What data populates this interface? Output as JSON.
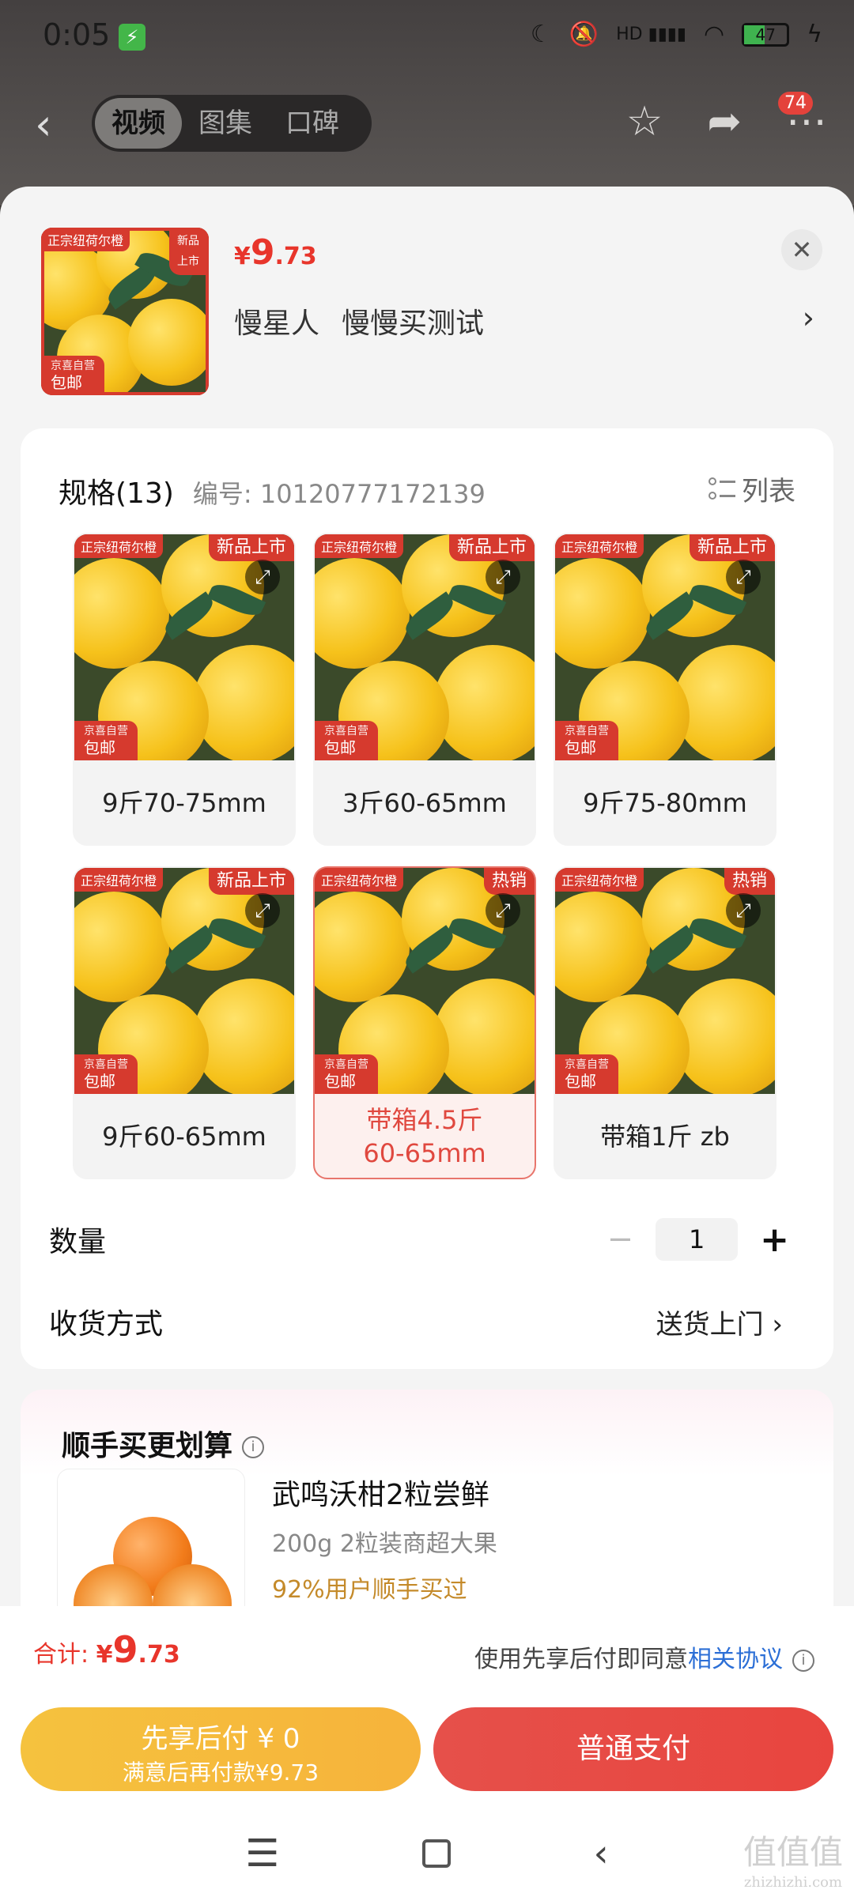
{
  "status_bar": {
    "time": "0:05",
    "hd": "HD",
    "battery": "47"
  },
  "nav": {
    "tabs": [
      "视频",
      "图集",
      "口碑"
    ],
    "active_tab": 0,
    "badge": "74"
  },
  "product": {
    "currency": "¥",
    "price_int": "9",
    "price_dec": ".73",
    "sellers": [
      "慢星人",
      "慢慢买测试"
    ]
  },
  "thumb_tags": {
    "brand": "正宗纽荷尔橙",
    "new": "新品上市",
    "self": "京喜自营",
    "ship": "包邮"
  },
  "spec": {
    "title": "规格(13)",
    "code": "编号: 10120777172139",
    "list_label": "列表",
    "items": [
      {
        "label": "9斤70-75mm",
        "tag": "新品上市",
        "selected": false
      },
      {
        "label": "3斤60-65mm",
        "tag": "新品上市",
        "selected": false
      },
      {
        "label": "9斤75-80mm",
        "tag": "新品上市",
        "selected": false
      },
      {
        "label": "9斤60-65mm",
        "tag": "新品上市",
        "selected": false
      },
      {
        "label": "带箱4.5斤\n60-65mm",
        "tag": "热销",
        "selected": true
      },
      {
        "label": "带箱1斤 zb",
        "tag": "热销",
        "selected": false
      }
    ]
  },
  "quantity": {
    "label": "数量",
    "value": "1",
    "minus": "−",
    "plus": "+"
  },
  "delivery": {
    "label": "收货方式",
    "value": "送货上门"
  },
  "addon": {
    "title": "顺手买更划算",
    "name": "武鸣沃柑2粒尝鲜",
    "desc": "200g 2粒装商超大果",
    "rate": "92%用户顺手买过"
  },
  "footer": {
    "total_label": "合计: ",
    "currency": "¥",
    "total_int": "9",
    "total_dec": ".73",
    "agree_text": "使用先享后付即同意",
    "agree_link": "相关协议",
    "later_line1": "先享后付 ¥ 0",
    "later_line2": "满意后再付款¥9.73",
    "pay_label": "普通支付"
  },
  "watermark": {
    "text": "值值值",
    "url": "zhizhizhi.com"
  },
  "colors": {
    "accent": "#e8352b",
    "gold": "#f5c23e",
    "link": "#2c6fd6"
  }
}
